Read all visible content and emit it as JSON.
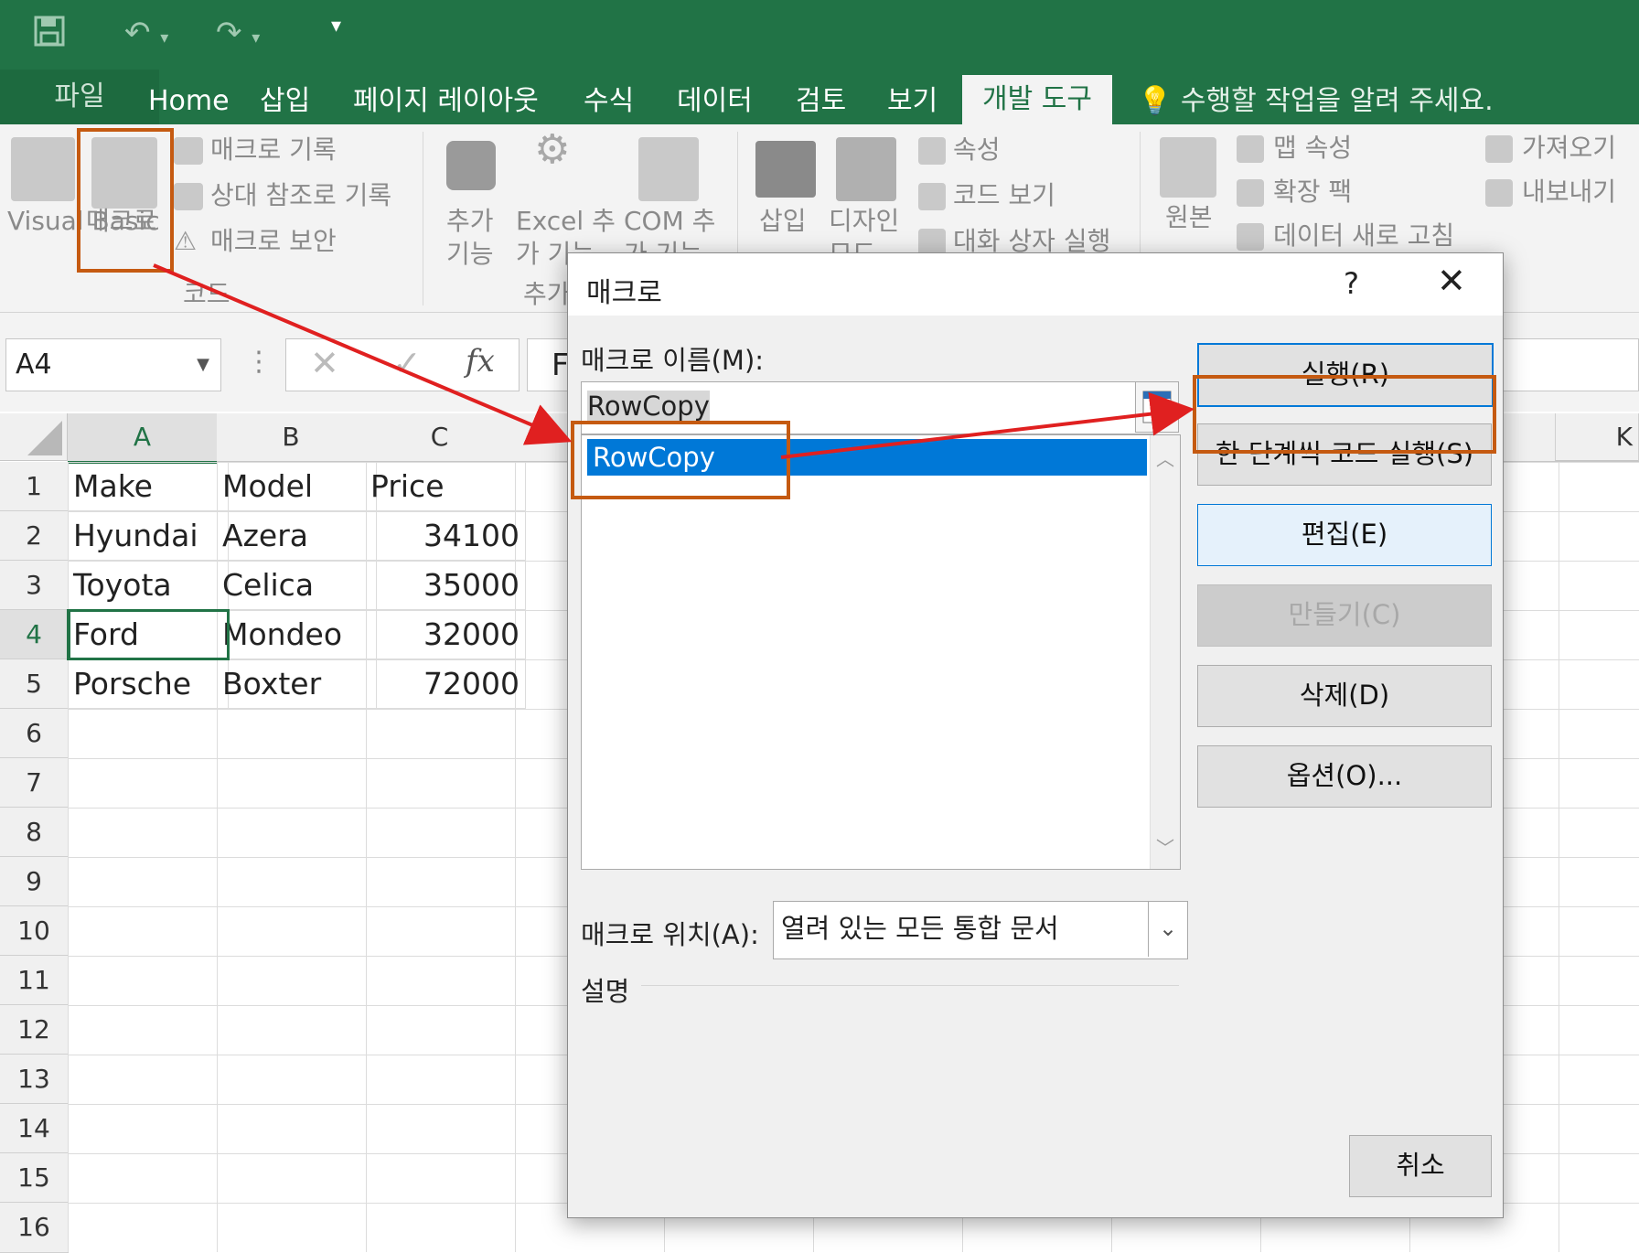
{
  "quick_access": {
    "save_icon": "save-icon",
    "undo_icon": "undo-icon",
    "redo_icon": "redo-icon",
    "more": "▾"
  },
  "tabs": [
    "파일",
    "Home",
    "삽입",
    "페이지 레이아웃",
    "수식",
    "데이터",
    "검토",
    "보기",
    "개발 도구"
  ],
  "tell_me": "수행할 작업을 알려 주세요.",
  "ribbon": {
    "code": {
      "visual_basic": "Visual Basic",
      "macro": "매크로",
      "record_macro": "매크로 기록",
      "relative_ref": "상대 참조로 기록",
      "macro_security": "매크로 보안",
      "group": "코드"
    },
    "addins": {
      "addins": "추가 기능",
      "excel_addins": "Excel 추가 기능",
      "com_addins": "COM 추가 기능",
      "group": "추가"
    },
    "controls": {
      "insert": "삽입",
      "design_mode": "디자인 모드",
      "properties": "속성",
      "view_code": "코드 보기",
      "run_dialog": "대화 상자 실행"
    },
    "xml": {
      "source": "원본",
      "map_properties": "맵 속성",
      "expansion_pack": "확장 팩",
      "refresh_data": "데이터 새로 고침",
      "import": "가져오기",
      "export": "내보내기"
    }
  },
  "formula_bar": {
    "name_box": "A4",
    "formula": "F"
  },
  "grid": {
    "columns": [
      "A",
      "B",
      "C",
      "K"
    ],
    "rows": [
      "1",
      "2",
      "3",
      "4",
      "5",
      "6",
      "7",
      "8",
      "9",
      "10",
      "11",
      "12",
      "13",
      "14",
      "15",
      "16"
    ],
    "cells": [
      [
        "Make",
        "Model",
        "Price"
      ],
      [
        "Hyundai",
        "Azera",
        "34100"
      ],
      [
        "Toyota",
        "Celica",
        "35000"
      ],
      [
        "Ford",
        "Mondeo",
        "32000"
      ],
      [
        "Porsche",
        "Boxter",
        "72000"
      ]
    ]
  },
  "dialog": {
    "title": "매크로",
    "help": "?",
    "close": "✕",
    "name_label": "매크로 이름(M):",
    "name_value": "RowCopy",
    "list": [
      "RowCopy"
    ],
    "buttons": {
      "run": "실행(R)",
      "step": "한 단계씩 코드 실행(S)",
      "edit": "편집(E)",
      "create": "만들기(C)",
      "delete": "삭제(D)",
      "options": "옵션(O)...",
      "cancel": "취소"
    },
    "location_label": "매크로 위치(A):",
    "location_value": "열려 있는 모든 통합 문서",
    "description_label": "설명"
  },
  "colors": {
    "excel_green": "#217346",
    "selection_blue": "#0078d7",
    "annotation": "#c55a11",
    "arrow": "#e02020"
  }
}
